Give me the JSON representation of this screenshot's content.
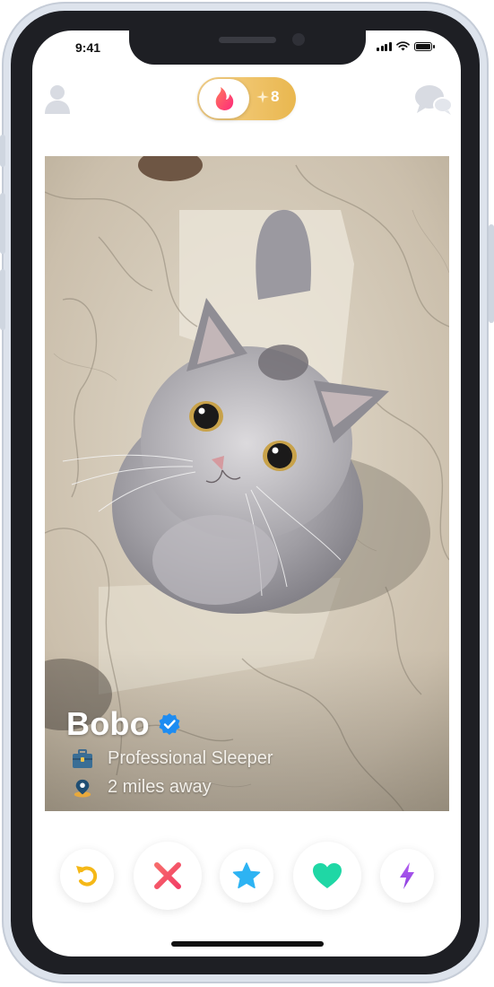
{
  "status_bar": {
    "time": "9:41"
  },
  "header": {
    "profile_icon": "profile-icon",
    "chat_icon": "chat-icon",
    "logo_icon": "flame-icon",
    "likes_count": "8",
    "spark_icon": "sparkle-icon"
  },
  "card": {
    "name": "Bobo",
    "verified_icon": "verified-badge-icon",
    "job_icon": "briefcase-icon",
    "job": "Professional Sleeper",
    "distance_icon": "location-pin-icon",
    "distance": "2 miles away"
  },
  "actions": [
    {
      "name": "rewind",
      "icon": "rewind-icon",
      "color": "#f5b817"
    },
    {
      "name": "nope",
      "icon": "x-icon",
      "color": "#f4495d"
    },
    {
      "name": "super-like",
      "icon": "star-icon",
      "color": "#2db3f3"
    },
    {
      "name": "like",
      "icon": "heart-icon",
      "color": "#1fd7a5"
    },
    {
      "name": "boost",
      "icon": "lightning-icon",
      "color": "#a34ee7"
    }
  ],
  "colors": {
    "brand_gradient_start": "#ff6b6b",
    "brand_gradient_end": "#fd297b",
    "gold_start": "#f6d28b",
    "gold_end": "#e9b74f",
    "verified_blue": "#1d8cf2"
  }
}
